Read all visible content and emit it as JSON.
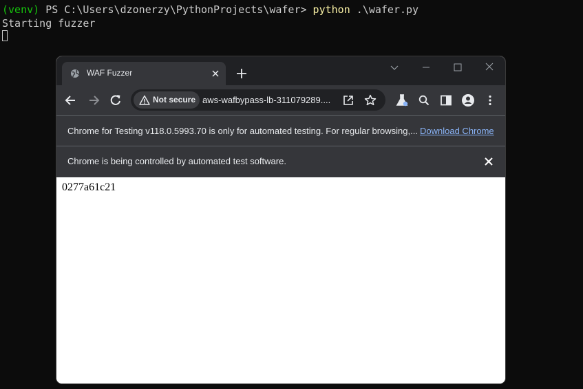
{
  "terminal": {
    "prompt_venv": "(venv)",
    "prompt_path": " PS C:\\Users\\dzonerzy\\PythonProjects\\wafer> ",
    "command": "python",
    "command_arg": " .\\wafer.py",
    "output_line": "Starting fuzzer"
  },
  "browser": {
    "tab": {
      "title": "WAF Fuzzer",
      "favicon": "globe-icon"
    },
    "omnibox": {
      "security_label": "Not secure",
      "url": "aws-wafbypass-lb-311079289...."
    },
    "infobars": {
      "testing_notice": "Chrome for Testing v118.0.5993.70 is only for automated testing. For regular browsing,...",
      "download_link": "Download Chrome",
      "automation_notice": "Chrome is being controlled by automated test software."
    },
    "content": {
      "text": "0277a61c21"
    }
  },
  "colors": {
    "terminal_bg": "#0c0c0c",
    "venv_green": "#16c60c",
    "command_yellow": "#f9f1a5",
    "chrome_dark": "#35363a",
    "link_blue": "#8ab4f8"
  }
}
